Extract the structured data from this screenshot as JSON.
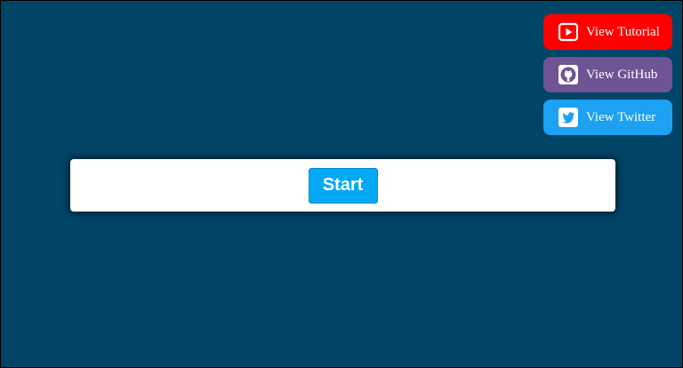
{
  "links": {
    "tutorial_label": "View Tutorial",
    "github_label": "View GitHub",
    "twitter_label": "View Twitter"
  },
  "main": {
    "start_label": "Start"
  },
  "icons": {
    "tutorial": "youtube-icon",
    "github": "github-icon",
    "twitter": "twitter-icon"
  },
  "colors": {
    "background": "#004466",
    "youtube": "#ff0000",
    "github": "#6e5494",
    "twitter": "#1da1f2",
    "start": "#03a9f4"
  }
}
